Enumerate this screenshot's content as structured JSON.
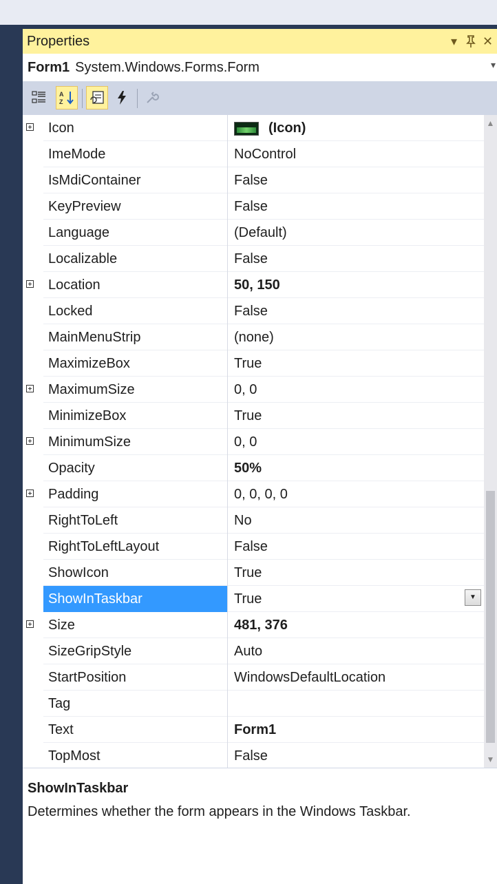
{
  "panel": {
    "title": "Properties",
    "controls": {
      "menu": "▾",
      "pin": "Ԩ",
      "close": "✕"
    }
  },
  "object_selector": {
    "name": "Form1",
    "type": "System.Windows.Forms.Form"
  },
  "toolbar": {
    "buttons": [
      {
        "id": "categorized",
        "icon": "categorized-icon",
        "active": false
      },
      {
        "id": "alphabetical",
        "icon": "alphabetical-icon",
        "active": true
      },
      {
        "id": "properties",
        "icon": "properties-icon",
        "active": true
      },
      {
        "id": "events",
        "icon": "events-lightning-icon",
        "active": false
      },
      {
        "id": "property-pages",
        "icon": "wrench-icon",
        "active": false
      }
    ]
  },
  "properties": [
    {
      "name": "Icon",
      "value": "(Icon)",
      "bold": true,
      "expandable": true,
      "thumb": true
    },
    {
      "name": "ImeMode",
      "value": "NoControl",
      "bold": false,
      "expandable": false
    },
    {
      "name": "IsMdiContainer",
      "value": "False",
      "bold": false,
      "expandable": false
    },
    {
      "name": "KeyPreview",
      "value": "False",
      "bold": false,
      "expandable": false
    },
    {
      "name": "Language",
      "value": "(Default)",
      "bold": false,
      "expandable": false
    },
    {
      "name": "Localizable",
      "value": "False",
      "bold": false,
      "expandable": false
    },
    {
      "name": "Location",
      "value": "50, 150",
      "bold": true,
      "expandable": true
    },
    {
      "name": "Locked",
      "value": "False",
      "bold": false,
      "expandable": false
    },
    {
      "name": "MainMenuStrip",
      "value": "(none)",
      "bold": false,
      "expandable": false
    },
    {
      "name": "MaximizeBox",
      "value": "True",
      "bold": false,
      "expandable": false
    },
    {
      "name": "MaximumSize",
      "value": "0, 0",
      "bold": false,
      "expandable": true
    },
    {
      "name": "MinimizeBox",
      "value": "True",
      "bold": false,
      "expandable": false
    },
    {
      "name": "MinimumSize",
      "value": "0, 0",
      "bold": false,
      "expandable": true
    },
    {
      "name": "Opacity",
      "value": "50%",
      "bold": true,
      "expandable": false
    },
    {
      "name": "Padding",
      "value": "0, 0, 0, 0",
      "bold": false,
      "expandable": true
    },
    {
      "name": "RightToLeft",
      "value": "No",
      "bold": false,
      "expandable": false
    },
    {
      "name": "RightToLeftLayout",
      "value": "False",
      "bold": false,
      "expandable": false
    },
    {
      "name": "ShowIcon",
      "value": "True",
      "bold": false,
      "expandable": false
    },
    {
      "name": "ShowInTaskbar",
      "value": "True",
      "bold": false,
      "expandable": false,
      "selected": true,
      "dropdown": true
    },
    {
      "name": "Size",
      "value": "481, 376",
      "bold": true,
      "expandable": true
    },
    {
      "name": "SizeGripStyle",
      "value": "Auto",
      "bold": false,
      "expandable": false
    },
    {
      "name": "StartPosition",
      "value": "WindowsDefaultLocation",
      "bold": false,
      "expandable": false
    },
    {
      "name": "Tag",
      "value": "",
      "bold": false,
      "expandable": false
    },
    {
      "name": "Text",
      "value": "Form1",
      "bold": true,
      "expandable": false
    },
    {
      "name": "TopMost",
      "value": "False",
      "bold": false,
      "expandable": false
    }
  ],
  "description": {
    "title": "ShowInTaskbar",
    "text": "Determines whether the form appears in the Windows Taskbar."
  },
  "colors": {
    "title_bar": "#fff29d",
    "selection": "#3399ff",
    "toolbar": "#cfd6e5",
    "frame": "#293955"
  }
}
